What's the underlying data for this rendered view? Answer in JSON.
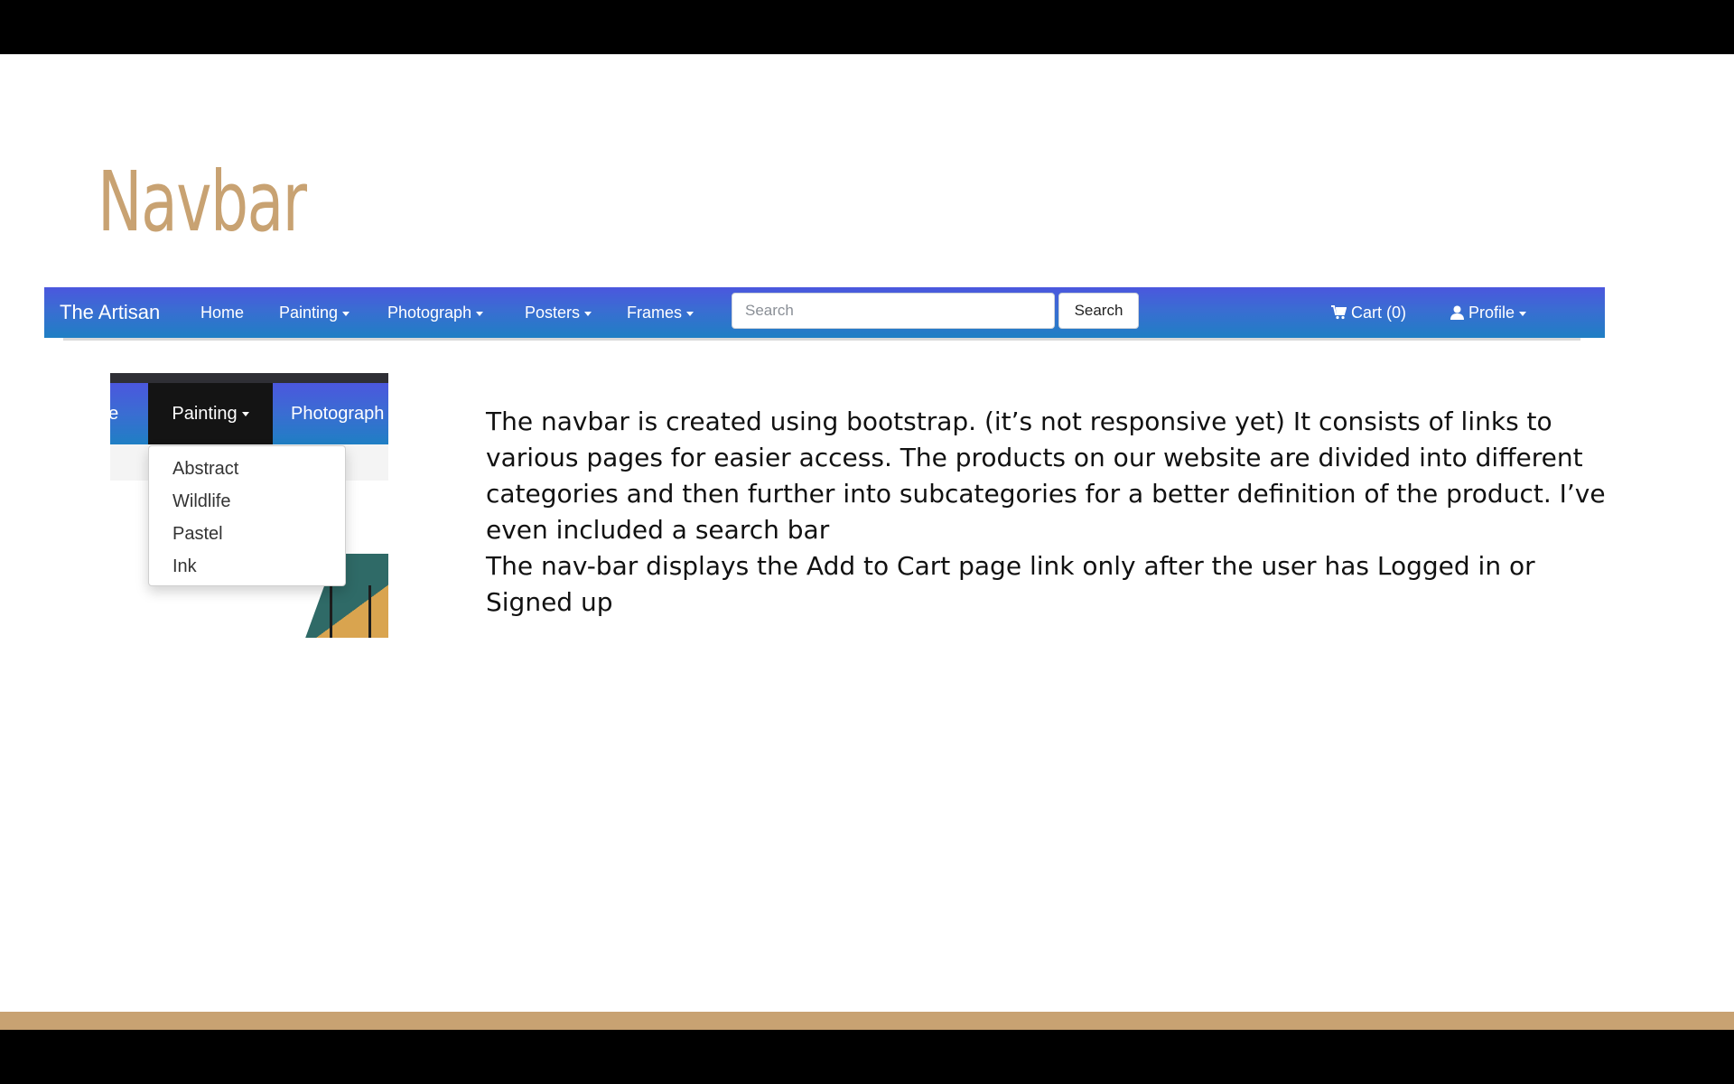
{
  "slide": {
    "title": "Navbar",
    "description": [
      "The navbar is created using bootstrap. (it’s not responsive yet) It consists of links to various pages for easier access. The products on our website are divided into different categories and then further into subcategories for a better definition of the product. I’ve even included a search bar",
      "The nav-bar displays the Add to Cart page link only after the user has Logged in or Signed up"
    ],
    "accent_color": "#c8a272"
  },
  "navbar": {
    "brand": "The Artisan",
    "links": [
      "Home",
      "Painting",
      "Photograph",
      "Posters",
      "Frames"
    ],
    "search_placeholder": "Search",
    "search_button": "Search",
    "cart": "Cart (0)",
    "profile": "Profile",
    "cart_icon": "cart-icon",
    "profile_icon": "user-icon",
    "gradient_top": "#4b57de",
    "gradient_bottom": "#1f7fc4"
  },
  "dropdown_crop": {
    "nav_items": [
      "ne",
      "Painting",
      "Photograph"
    ],
    "menu_items": [
      "Abstract",
      "Wildlife",
      "Pastel",
      "Ink"
    ],
    "active_bg": "#141414"
  }
}
